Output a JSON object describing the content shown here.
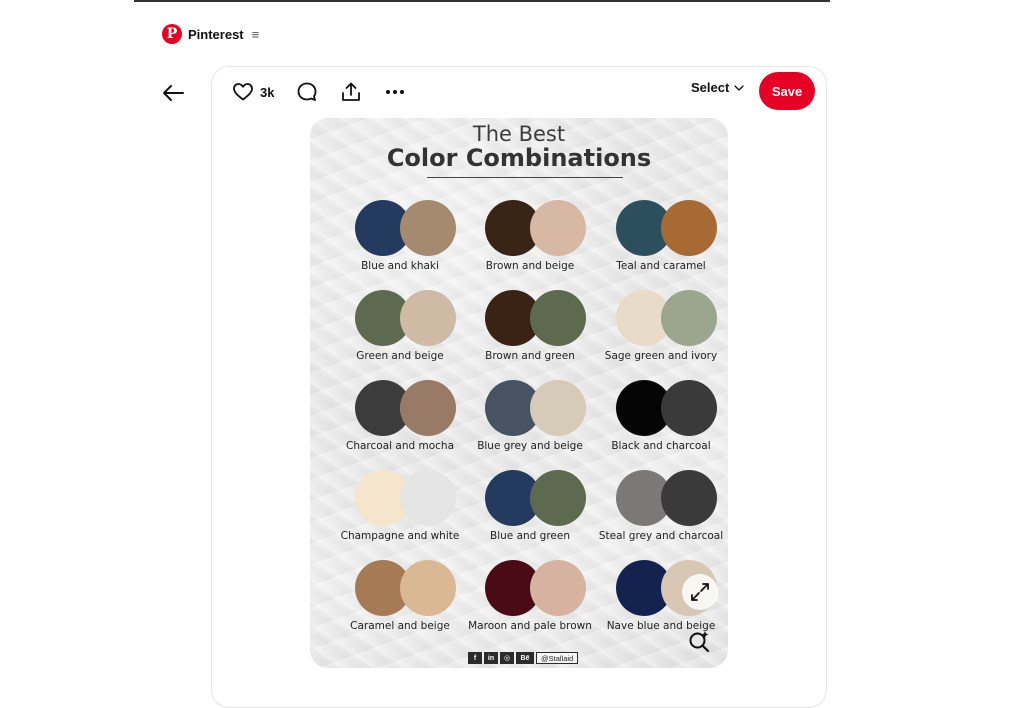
{
  "brand": {
    "name": "Pinterest",
    "logo_letter": "P",
    "menu_glyph": "≡"
  },
  "toolbar": {
    "like_count": "3k",
    "select_label": "Select",
    "save_label": "Save"
  },
  "pin": {
    "title_line1": "The Best",
    "title_line2": "Color Combinations",
    "combos": [
      {
        "label": "Blue and khaki",
        "colors": [
          "#243a5e",
          "#a58a70"
        ]
      },
      {
        "label": "Brown and beige",
        "colors": [
          "#3a2416",
          "#d6b8a4"
        ]
      },
      {
        "label": "Teal and caramel",
        "colors": [
          "#2c4f5e",
          "#a76a32"
        ]
      },
      {
        "label": "Green and beige",
        "colors": [
          "#5e6a50",
          "#cfbba5"
        ]
      },
      {
        "label": "Brown and green",
        "colors": [
          "#3a2314",
          "#5e6a4e"
        ]
      },
      {
        "label": "Sage green and ivory",
        "colors": [
          "#e8dcc8",
          "#9ca68e"
        ]
      },
      {
        "label": "Charcoal and mocha",
        "colors": [
          "#3c3c3c",
          "#987a66"
        ]
      },
      {
        "label": "Blue grey and beige",
        "colors": [
          "#475362",
          "#d5cbb8"
        ]
      },
      {
        "label": "Black and charcoal",
        "colors": [
          "#050505",
          "#3a3a3a"
        ]
      },
      {
        "label": "Champagne and white",
        "colors": [
          "#f5e5cc",
          "#e5e5e5"
        ]
      },
      {
        "label": "Blue and green",
        "colors": [
          "#243a5e",
          "#5e6a50"
        ]
      },
      {
        "label": "Steal grey and charcoal",
        "colors": [
          "#7d7878",
          "#3a3a3a"
        ]
      },
      {
        "label": "Caramel and beige",
        "colors": [
          "#a67a55",
          "#d9b893"
        ]
      },
      {
        "label": "Maroon and pale brown",
        "colors": [
          "#4a0b16",
          "#d6b3a0"
        ]
      },
      {
        "label": "Nave blue and beige",
        "colors": [
          "#13224f",
          "#d8c7b3"
        ]
      }
    ],
    "social": {
      "icons": [
        "f",
        "in",
        "◎",
        "Bē"
      ],
      "handle": "@Stallaid"
    }
  },
  "colors": {
    "accent": "#e60023"
  },
  "icons": {
    "back": "arrow-left-icon",
    "like": "heart-icon",
    "comment": "comment-icon",
    "share": "share-icon",
    "more": "more-icon",
    "select_caret": "chevron-down-icon",
    "expand": "expand-icon",
    "visual_search": "lens-icon"
  }
}
